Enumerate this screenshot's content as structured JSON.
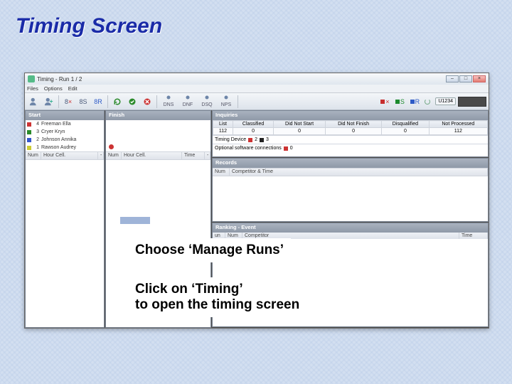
{
  "slide": {
    "title": "Timing Screen"
  },
  "window": {
    "title": "Timing - Run 1 / 2",
    "menu": {
      "files": "Files",
      "options": "Options",
      "edit": "Edit"
    },
    "toolbar": {
      "user_icon": "user-icon",
      "eight_s": "8S",
      "eight_r": "8R",
      "dns": "DNS",
      "dnf": "DNF",
      "dsq": "DSQ",
      "nps": "NPS",
      "s": "S",
      "r": "R",
      "code": "U1234"
    }
  },
  "start": {
    "header": "Start",
    "rows": [
      {
        "flag": "r",
        "num": "4",
        "name": "Freeman Ella"
      },
      {
        "flag": "g",
        "num": "3",
        "name": "Cryer Kryn"
      },
      {
        "flag": "b",
        "num": "2",
        "name": "Johnson Annika"
      },
      {
        "flag": "y",
        "num": "1",
        "name": "Rawson Audrey"
      }
    ],
    "cols": {
      "num": "Num",
      "hour": "Hour Cell."
    }
  },
  "finish": {
    "header": "Finish",
    "cols": {
      "num": "Num",
      "hour": "Hour Cell.",
      "time": "Time"
    }
  },
  "inquiries": {
    "header": "Inquiries",
    "cols": {
      "list": "List",
      "classified": "Classified",
      "dns": "Did Not Start",
      "dnf": "Did Not Finish",
      "dsq": "Disqualified",
      "np": "Not Processed"
    },
    "vals": {
      "list": "112",
      "classified": "0",
      "dns": "0",
      "dnf": "0",
      "dsq": "0",
      "np": "112"
    },
    "timing_device": "Timing Device",
    "td_a": "2",
    "td_b": "3",
    "opt_conn": "Optional software connections",
    "opt_v": "0"
  },
  "records": {
    "header": "Records",
    "cols": {
      "num": "Num",
      "comp": "Competitor & Time"
    }
  },
  "ranking": {
    "header": "Ranking - Event",
    "cols": {
      "un": "un",
      "num": "Num",
      "comp": "Competitor",
      "time": "Time"
    }
  },
  "callouts": {
    "a": "Choose ‘Manage Runs’",
    "b1": "Click on ‘Timing’",
    "b2": "to open the timing screen"
  }
}
